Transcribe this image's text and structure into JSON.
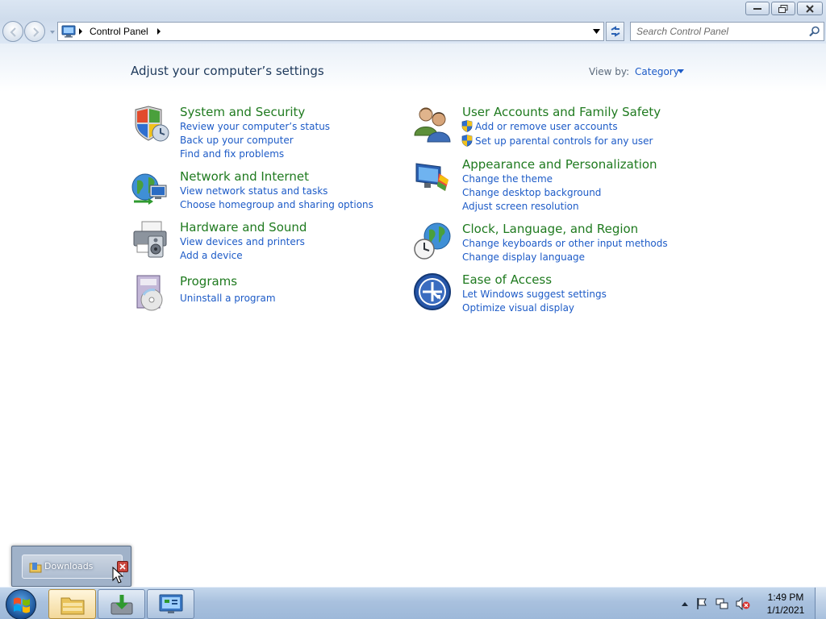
{
  "window": {
    "buttons": [
      "minimize",
      "restore",
      "close"
    ]
  },
  "navigation": {
    "breadcrumb": "Control Panel",
    "search_placeholder": "Search Control Panel"
  },
  "header": {
    "title": "Adjust your computer’s settings",
    "view_by_label": "View by:",
    "view_by_value": "Category"
  },
  "categories": [
    {
      "title": "System and Security",
      "icon": "shield-icon",
      "links": [
        "Review your computer’s status",
        "Back up your computer",
        "Find and fix problems"
      ]
    },
    {
      "title": "Network and Internet",
      "icon": "network-globe-icon",
      "links": [
        "View network status and tasks",
        "Choose homegroup and sharing options"
      ]
    },
    {
      "title": "Hardware and Sound",
      "icon": "printer-speaker-icon",
      "links": [
        "View devices and printers",
        "Add a device"
      ]
    },
    {
      "title": "Programs",
      "icon": "programs-disc-icon",
      "links": [
        "Uninstall a program"
      ]
    },
    {
      "title": "User Accounts and Family Safety",
      "icon": "users-icon",
      "links": [
        "Add or remove user accounts",
        "Set up parental controls for any user"
      ]
    },
    {
      "title": "Appearance and Personalization",
      "icon": "monitor-paint-icon",
      "links": [
        "Change the theme",
        "Change desktop background",
        "Adjust screen resolution"
      ]
    },
    {
      "title": "Clock, Language, and Region",
      "icon": "clock-globe-icon",
      "links": [
        "Change keyboards or other input methods",
        "Change display language"
      ]
    },
    {
      "title": "Ease of Access",
      "icon": "ease-of-access-icon",
      "links": [
        "Let Windows suggest settings",
        "Optimize visual display"
      ]
    }
  ],
  "popup": {
    "item_label": "Downloads"
  },
  "taskbar": {
    "buttons": [
      "windows-explorer",
      "downloads-app",
      "control-panel"
    ],
    "time": "1:49 PM",
    "date": "1/1/2021"
  },
  "colors": {
    "category_title": "#1f7a1f",
    "link": "#1d5bc7",
    "heading": "#1e395b"
  }
}
